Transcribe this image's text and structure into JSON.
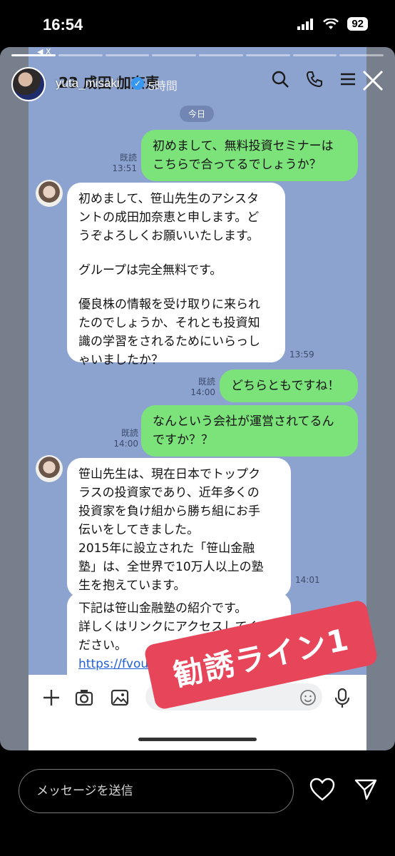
{
  "status_bar": {
    "time": "16:54",
    "battery": "92"
  },
  "story": {
    "username": "yuta_misaki",
    "posted_ago": "5時間",
    "tiny_mark": "◀ X"
  },
  "chat": {
    "title": "23 成田 加奈恵",
    "date_label": "今日",
    "messages": [
      {
        "side": "out",
        "text_lines": [
          "初めまして、無料投資セミナーは",
          "こちらで合ってるでしょうか？"
        ],
        "read": "既読",
        "time": "13:51"
      },
      {
        "side": "in",
        "text_lines": [
          "初めまして、笹山先生のアシスタ",
          "ントの成田加奈恵と申します。ど",
          "うぞよろしくお願いいたします。",
          "",
          "グループは完全無料です。",
          "",
          "優良株の情報を受け取りに来られ",
          "たのでしょうか、それとも投資知",
          "識の学習をされるためにいらっし",
          "ゃいましたか？"
        ],
        "time": "13:59"
      },
      {
        "side": "out",
        "text_lines": [
          "どちらともですね！"
        ],
        "read": "既読",
        "time": "14:00"
      },
      {
        "side": "out",
        "text_lines": [
          "なんという会社が運営されてるん",
          "ですか？？"
        ],
        "read": "既読",
        "time": "14:00"
      },
      {
        "side": "in",
        "text_lines": [
          "笹山先生は、現在日本でトップク",
          "ラスの投資家であり、近年多くの",
          "投資家を負け組から勝ち組にお手",
          "伝いをしてきました。",
          "2015年に設立された「笹山金融",
          "塾」は、全世界で10万人以上の塾",
          "生を抱えています。"
        ],
        "time": "14:01"
      },
      {
        "side": "in",
        "text_lines": [
          "下記は笹山金融塾の紹介です。",
          "詳しくはリンクにアクセスしてく",
          "ださい。"
        ],
        "link": "https://fvou",
        "time": ""
      }
    ]
  },
  "sticker": {
    "text": "勧誘ライン1"
  },
  "footer": {
    "reply_placeholder": "メッセージを送信"
  },
  "icons": [
    "back-arrow-icon",
    "verified-icon",
    "search-icon",
    "phone-icon",
    "menu-icon",
    "close-icon",
    "plus-icon",
    "camera-icon",
    "image-icon",
    "emoji-icon",
    "mic-icon",
    "heart-icon",
    "send-icon"
  ],
  "colors": {
    "outgoing_bubble": "#7ce27a",
    "incoming_bubble": "#ffffff",
    "chat_background": "#8ca3cf",
    "sticker": "#e7455a"
  }
}
